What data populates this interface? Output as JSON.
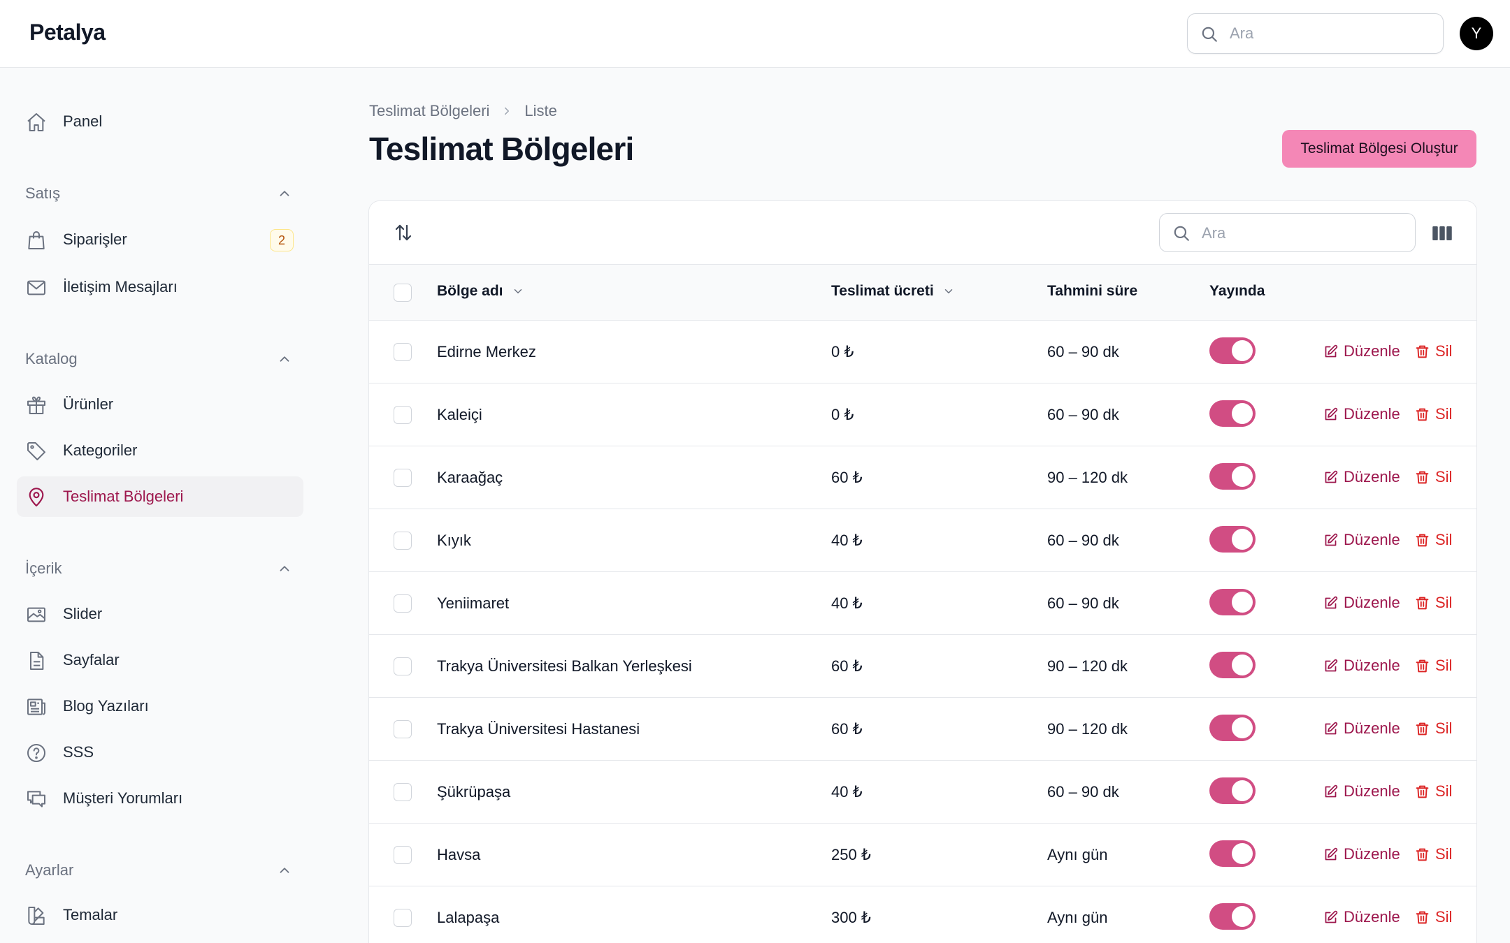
{
  "app": {
    "brand": "Petalya",
    "avatar_initial": "Y"
  },
  "top_search": {
    "placeholder": "Ara"
  },
  "sidebar": {
    "panel": {
      "label": "Panel",
      "icon": "home-icon"
    },
    "groups": [
      {
        "label": "Satış",
        "items": [
          {
            "label": "Siparişler",
            "icon": "shopping-bag-icon",
            "badge": "2"
          },
          {
            "label": "İletişim Mesajları",
            "icon": "envelope-icon"
          }
        ]
      },
      {
        "label": "Katalog",
        "items": [
          {
            "label": "Ürünler",
            "icon": "gift-icon"
          },
          {
            "label": "Kategoriler",
            "icon": "tag-icon"
          },
          {
            "label": "Teslimat Bölgeleri",
            "icon": "map-pin-icon",
            "active": true
          }
        ]
      },
      {
        "label": "İçerik",
        "items": [
          {
            "label": "Slider",
            "icon": "image-icon"
          },
          {
            "label": "Sayfalar",
            "icon": "document-icon"
          },
          {
            "label": "Blog Yazıları",
            "icon": "newspaper-icon"
          },
          {
            "label": "SSS",
            "icon": "question-circle-icon"
          },
          {
            "label": "Müşteri Yorumları",
            "icon": "chat-bubbles-icon"
          }
        ]
      },
      {
        "label": "Ayarlar",
        "items": [
          {
            "label": "Temalar",
            "icon": "swatch-icon"
          }
        ]
      }
    ]
  },
  "breadcrumb": {
    "parent": "Teslimat Bölgeleri",
    "current": "Liste"
  },
  "page": {
    "title": "Teslimat Bölgeleri",
    "create_label": "Teslimat Bölgesi Oluştur"
  },
  "table": {
    "search_placeholder": "Ara",
    "headers": {
      "name": "Bölge adı",
      "fee": "Teslimat ücreti",
      "duration": "Tahmini süre",
      "published": "Yayında"
    },
    "actions": {
      "edit": "Düzenle",
      "delete": "Sil"
    },
    "rows": [
      {
        "name": "Edirne Merkez",
        "fee": "0 ₺",
        "duration": "60 – 90 dk",
        "published": true
      },
      {
        "name": "Kaleiçi",
        "fee": "0 ₺",
        "duration": "60 – 90 dk",
        "published": true
      },
      {
        "name": "Karaağaç",
        "fee": "60 ₺",
        "duration": "90 – 120 dk",
        "published": true
      },
      {
        "name": "Kıyık",
        "fee": "40 ₺",
        "duration": "60 – 90 dk",
        "published": true
      },
      {
        "name": "Yeniimaret",
        "fee": "40 ₺",
        "duration": "60 – 90 dk",
        "published": true
      },
      {
        "name": "Trakya Üniversitesi Balkan Yerleşkesi",
        "fee": "60 ₺",
        "duration": "90 – 120 dk",
        "published": true
      },
      {
        "name": "Trakya Üniversitesi Hastanesi",
        "fee": "60 ₺",
        "duration": "90 – 120 dk",
        "published": true
      },
      {
        "name": "Şükrüpaşa",
        "fee": "40 ₺",
        "duration": "60 – 90 dk",
        "published": true
      },
      {
        "name": "Havsa",
        "fee": "250 ₺",
        "duration": "Aynı gün",
        "published": true
      },
      {
        "name": "Lalapaşa",
        "fee": "300 ₺",
        "duration": "Aynı gün",
        "published": true
      }
    ]
  },
  "colors": {
    "accent": "#9d174d",
    "primary_button": "#f487b6",
    "toggle_on": "#d14d83",
    "danger": "#dc2626"
  }
}
